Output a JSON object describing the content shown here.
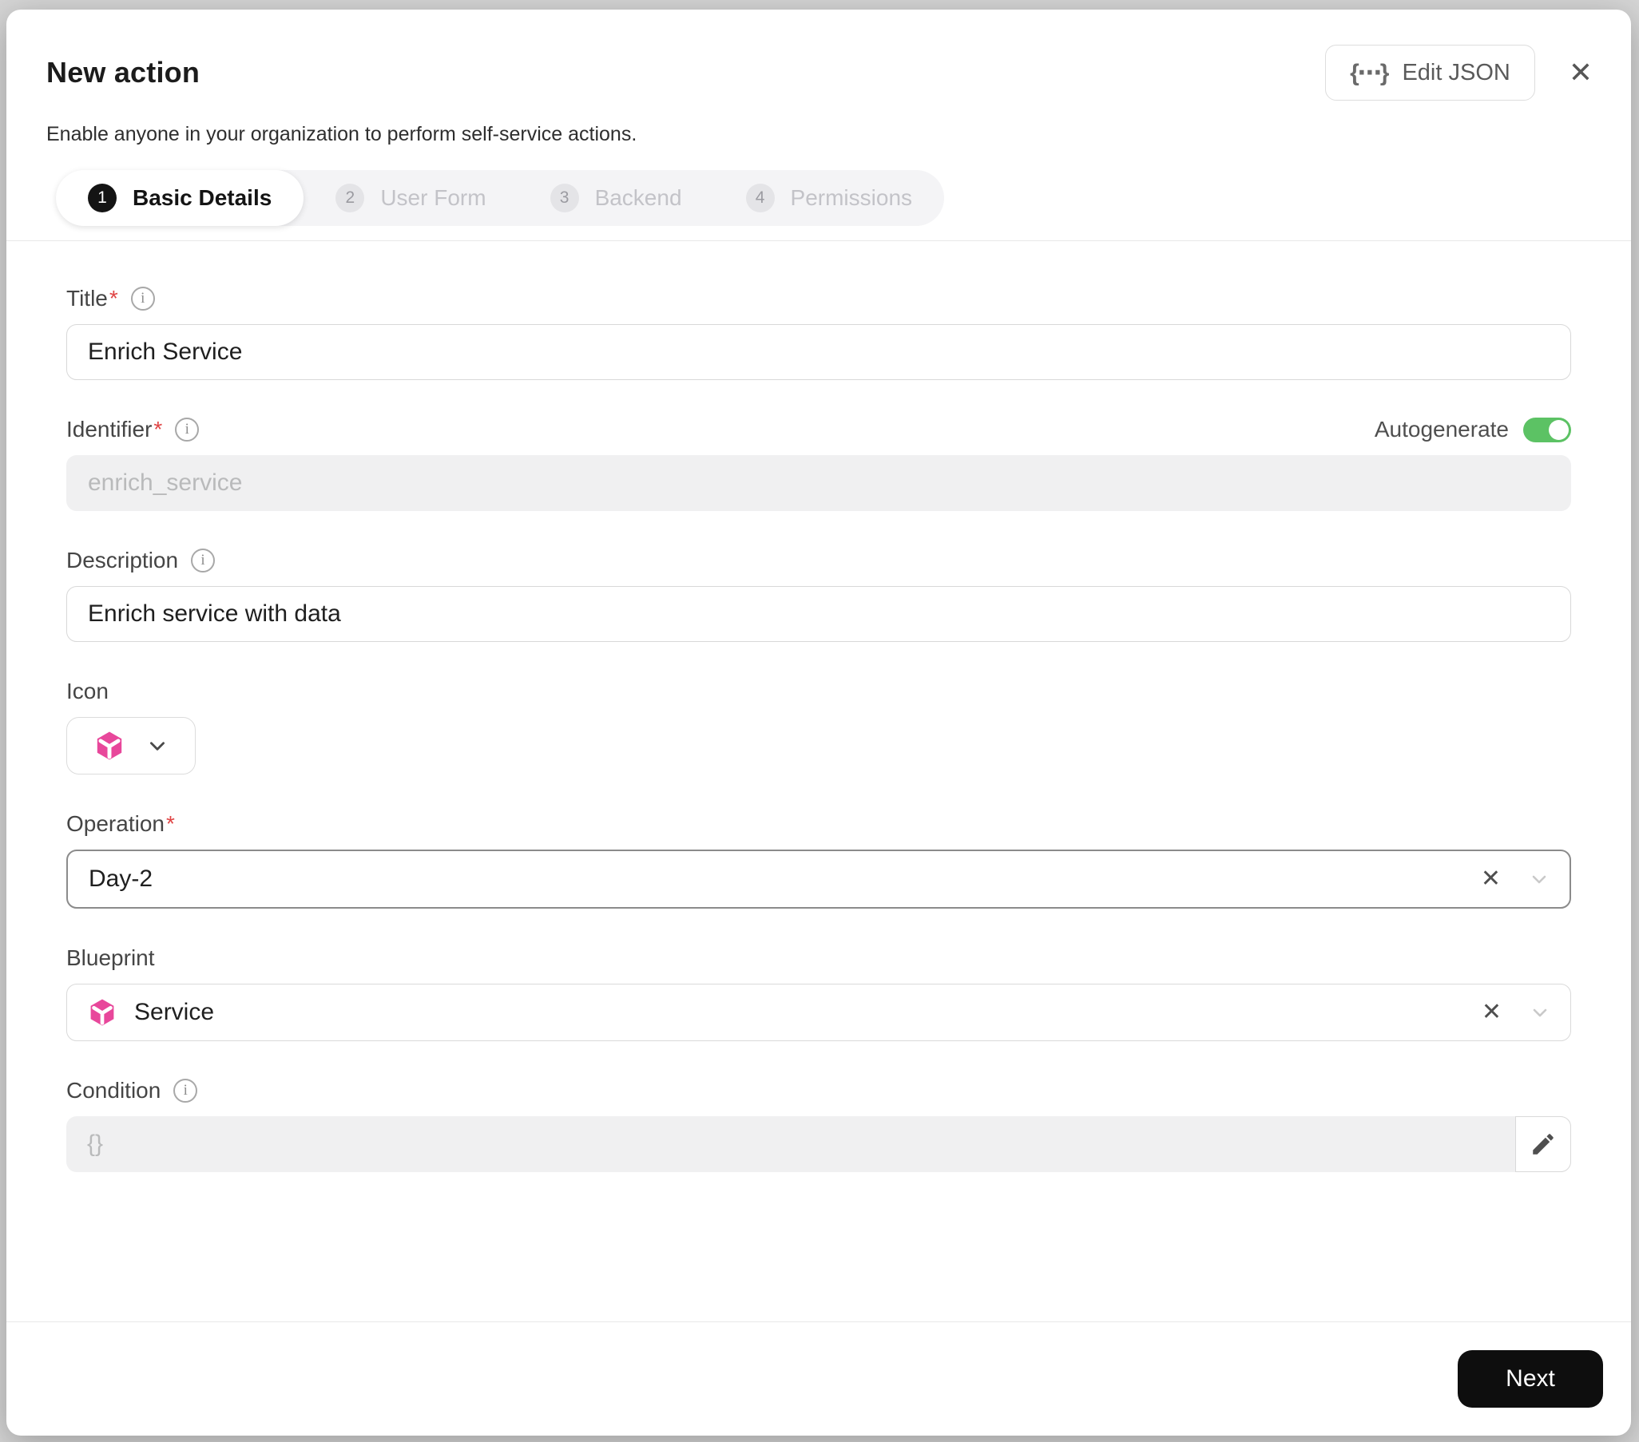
{
  "header": {
    "title": "New action",
    "subtitle": "Enable anyone in your organization to perform self-service actions.",
    "edit_json_label": "Edit JSON",
    "steps": [
      {
        "num": "1",
        "label": "Basic Details"
      },
      {
        "num": "2",
        "label": "User Form"
      },
      {
        "num": "3",
        "label": "Backend"
      },
      {
        "num": "4",
        "label": "Permissions"
      }
    ]
  },
  "icons": {
    "braces": "{⋯}",
    "close": "✕",
    "clear": "✕",
    "info": "i"
  },
  "form": {
    "title": {
      "label": "Title",
      "required_mark": "*",
      "value": "Enrich Service"
    },
    "identifier": {
      "label": "Identifier",
      "required_mark": "*",
      "value": "enrich_service",
      "autogenerate_label": "Autogenerate",
      "autogenerate_state": "on"
    },
    "description": {
      "label": "Description",
      "value": "Enrich service with data"
    },
    "icon": {
      "label": "Icon",
      "selected_icon": "service-cube"
    },
    "operation": {
      "label": "Operation",
      "required_mark": "*",
      "value": "Day-2"
    },
    "blueprint": {
      "label": "Blueprint",
      "value": "Service",
      "value_icon": "service-cube"
    },
    "condition": {
      "label": "Condition",
      "value": "{}"
    }
  },
  "footer": {
    "next_label": "Next"
  },
  "colors": {
    "toggle_green": "#5CC264",
    "blueprint_pink": "#E8479B",
    "next_button_bg": "#0E0E0E",
    "required_red": "#E04545"
  }
}
